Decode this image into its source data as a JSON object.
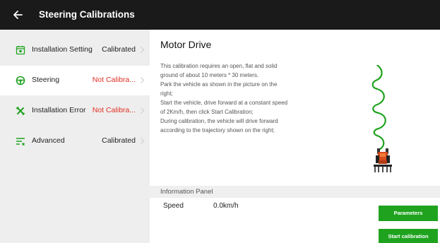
{
  "header": {
    "title": "Steering Calibrations"
  },
  "sidebar": {
    "items": [
      {
        "label": "Installation Setting",
        "status": "Calibrated",
        "state": "ok"
      },
      {
        "label": "Steering",
        "status": "Not Calibra...",
        "state": "bad"
      },
      {
        "label": "Installation Error",
        "status": "Not Calibra...",
        "state": "bad"
      },
      {
        "label": "Advanced",
        "status": "Calibrated",
        "state": "ok"
      }
    ]
  },
  "main": {
    "title": "Motor Drive",
    "description_lines": [
      "This calibration requires an open, flat and solid",
      "ground of about 10 meters * 30 meters.",
      " Park the vehicle as shown in the picture on the",
      "right;",
      " Start the vehicle, drive forward at a constant speed",
      "of 2Km/h, then click Start Calibration;",
      " During calibration, the vehicle will drive forward",
      "according to the trajectory shown on the right;"
    ],
    "info_panel": {
      "title": "Information Panel",
      "speed_label": "Speed",
      "speed_value": "0.0km/h"
    },
    "buttons": {
      "parameters": "Parameters",
      "start": "Start calibration"
    }
  },
  "colors": {
    "topbar": "#1a1a1a",
    "accent_green": "#1fa31f",
    "error_red": "#e02f24",
    "sidebar_bg": "#eeeeee"
  }
}
